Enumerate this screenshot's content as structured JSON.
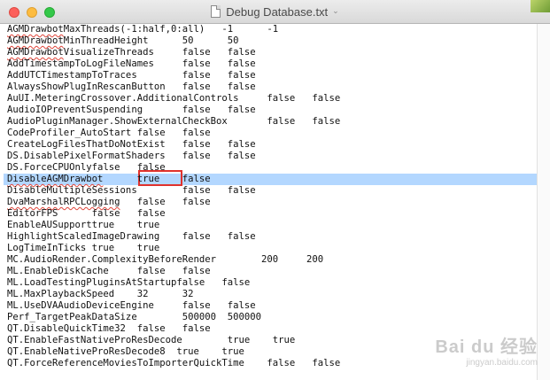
{
  "window": {
    "title": "Debug Database.txt",
    "chevron": "⌄"
  },
  "lines": [
    [
      "AGMDrawbotMaxThreads(-1:half,0:all)   -1      -1"
    ],
    [
      "AGMDrawbotMinThreadHeight      50      50"
    ],
    [
      "AGMDrawbotVisualizeThreads     false   false"
    ],
    [
      "AddTimestampToLogFileNames     false   false"
    ],
    [
      "AddUTCTimestampToTraces        false   false"
    ],
    [
      "AlwaysShowPlugInRescanButton   false   false"
    ],
    [
      "AuUI.MeteringCrossover.AdditionalControls     false   false"
    ],
    [
      "AudioIOPreventSuspending       false   false"
    ],
    [
      "AudioPluginManager.ShowExternalCheckBox       false   false"
    ],
    [
      "CodeProfiler_AutoStart false   false"
    ],
    [
      "CreateLogFilesThatDoNotExist   false   false"
    ],
    [
      "DS.DisablePixelFormatShaders   false   false"
    ],
    [
      "DS.ForceCPUOnlyfalse   false"
    ],
    [
      "DisableAGMDrawbot      true    false"
    ],
    [
      "DisableMultipleSessions        false   false"
    ],
    [
      "DvaMarshalRPCLogging   false   false"
    ],
    [
      "EditorFPS      false   false"
    ],
    [
      "EnableAUSupporttrue    true"
    ],
    [
      "HighlightScaledImageDrawing    false   false"
    ],
    [
      "LogTimeInTicks true    true"
    ],
    [
      "MC.AudioRender.ComplexityBeforeRender        200     200"
    ],
    [
      "ML.EnableDiskCache     false   false"
    ],
    [
      "ML.LoadTestingPluginsAtStartupfalse   false"
    ],
    [
      "ML.MaxPlaybackSpeed    32      32"
    ],
    [
      "ML.UseDVAAudioDeviceEngine     false   false"
    ],
    [
      "Perf_TargetPeakDataSize        500000  500000"
    ],
    [
      "QT.DisableQuickTime32  false   false"
    ],
    [
      "QT.EnableFastNativeProResDecode        true    true"
    ],
    [
      "QT.EnableNativeProResDecode8  true    true"
    ],
    [
      "QT.ForceReferenceMoviesToImporterQuickTime    false   false"
    ]
  ],
  "selected_line_index": 13,
  "spellchecked_prefixes": {
    "0": "AGMDrawbot",
    "1": "AGMDrawbot",
    "2": "AGMDrawbot",
    "13": "DisableAGMDrawbot",
    "15": "DvaMarshalRPCLogging"
  },
  "watermark": {
    "brand": "Bai du 经验",
    "url": "jingyan.baidu.com"
  }
}
